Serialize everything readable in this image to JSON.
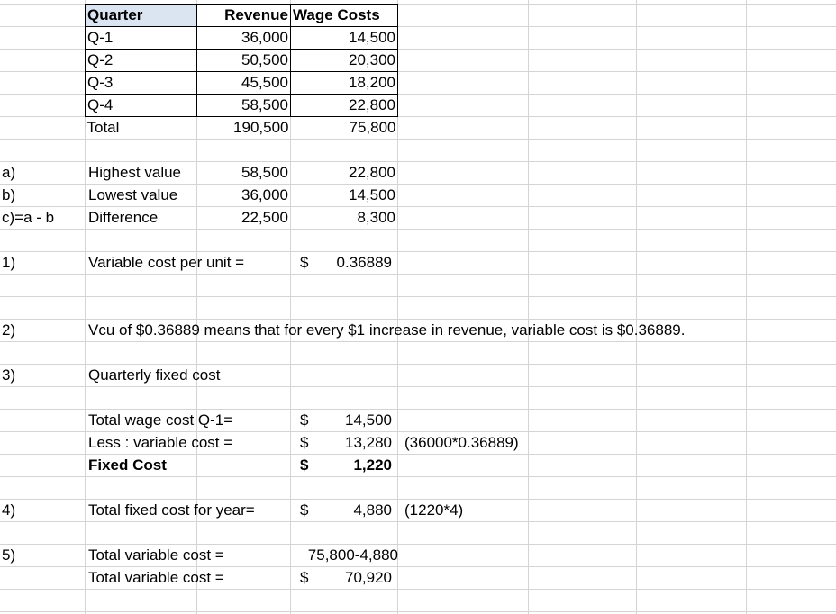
{
  "table": {
    "headers": [
      "Quarter",
      "Revenue",
      "Wage Costs"
    ],
    "rows": [
      {
        "quarter": "Q-1",
        "revenue": "36,000",
        "wage": "14,500"
      },
      {
        "quarter": "Q-2",
        "revenue": "50,500",
        "wage": "20,300"
      },
      {
        "quarter": "Q-3",
        "revenue": "45,500",
        "wage": "18,200"
      },
      {
        "quarter": "Q-4",
        "revenue": "58,500",
        "wage": "22,800"
      }
    ],
    "total": {
      "label": "Total",
      "revenue": "190,500",
      "wage": "75,800"
    }
  },
  "highlow": [
    {
      "ref": "a)",
      "label": "Highest value",
      "revenue": "58,500",
      "wage": "22,800"
    },
    {
      "ref": "b)",
      "label": "Lowest value",
      "revenue": "36,000",
      "wage": "14,500"
    },
    {
      "ref": "c)=a - b",
      "label": "Difference",
      "revenue": "22,500",
      "wage": "8,300"
    }
  ],
  "q1": {
    "ref": "1)",
    "label": "Variable cost per unit =",
    "currency": "$",
    "value": "0.36889"
  },
  "q2": {
    "ref": "2)",
    "text": "Vcu of $0.36889 means that for every $1 increase in revenue, variable cost is $0.36889."
  },
  "q3": {
    "ref": "3)",
    "title": "Quarterly fixed cost",
    "rows": [
      {
        "label": "Total wage cost Q-1=",
        "currency": "$",
        "value": "14,500",
        "note": ""
      },
      {
        "label": "Less : variable cost =",
        "currency": "$",
        "value": "13,280",
        "note": "(36000*0.36889)"
      },
      {
        "label": "Fixed Cost",
        "currency": "$",
        "value": "1,220",
        "note": ""
      }
    ]
  },
  "q4": {
    "ref": "4)",
    "label": "Total fixed cost for year=",
    "currency": "$",
    "value": "4,880",
    "note": "(1220*4)"
  },
  "q5": {
    "ref": "5)",
    "row1": {
      "label": "Total variable cost =",
      "value": "75,800-4,880"
    },
    "row2": {
      "label": "Total variable cost =",
      "currency": "$",
      "value": "70,920"
    }
  }
}
